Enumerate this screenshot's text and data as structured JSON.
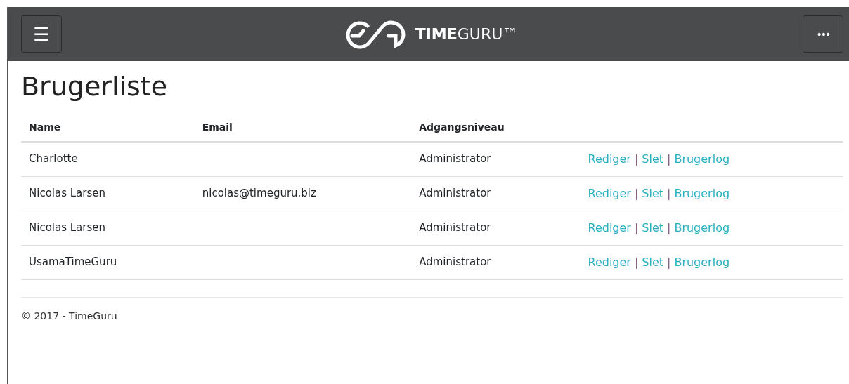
{
  "navbar": {
    "brand": "**TIME**GURU™",
    "menu_button": "☰",
    "more_button": "•••"
  },
  "title": "Brugerliste",
  "table": {
    "columns": [
      "Name",
      "Email",
      "Adgangsniveau"
    ],
    "rows": [
      {
        "name": "Charlotte",
        "email": "",
        "level": "Administrator",
        "actions": [
          {
            "kind": "link",
            "text": "Rediger"
          },
          {
            "kind": "separator",
            "text": "|"
          },
          {
            "kind": "link",
            "text": "Slet"
          },
          {
            "kind": "separator",
            "text": "|"
          },
          {
            "kind": "link",
            "text": "Brugerlog"
          }
        ]
      },
      {
        "name": "Nicolas Larsen",
        "email": "nicolas@timeguru.biz",
        "level": "Administrator",
        "actions": [
          {
            "kind": "link",
            "text": "Rediger"
          },
          {
            "kind": "separator",
            "text": "|"
          },
          {
            "kind": "link",
            "text": "Slet"
          },
          {
            "kind": "separator",
            "text": "|"
          },
          {
            "kind": "link",
            "text": "Brugerlog"
          }
        ]
      },
      {
        "name": "Nicolas Larsen",
        "email": "",
        "level": "Administrator",
        "actions": [
          {
            "kind": "link",
            "text": "Rediger"
          },
          {
            "kind": "separator",
            "text": "|"
          },
          {
            "kind": "link",
            "text": "Slet"
          },
          {
            "kind": "separator",
            "text": "|"
          },
          {
            "kind": "link",
            "text": "Brugerlog"
          }
        ]
      },
      {
        "name": "UsamaTimeGuru",
        "email": "",
        "level": "Administrator",
        "actions": [
          {
            "kind": "link",
            "text": "Rediger"
          },
          {
            "kind": "separator",
            "text": "|"
          },
          {
            "kind": "link",
            "text": "Slet"
          },
          {
            "kind": "separator",
            "text": "|"
          },
          {
            "kind": "link",
            "text": "Brugerlog"
          }
        ]
      }
    ]
  },
  "footer": "© 2017 - TimeGuru"
}
